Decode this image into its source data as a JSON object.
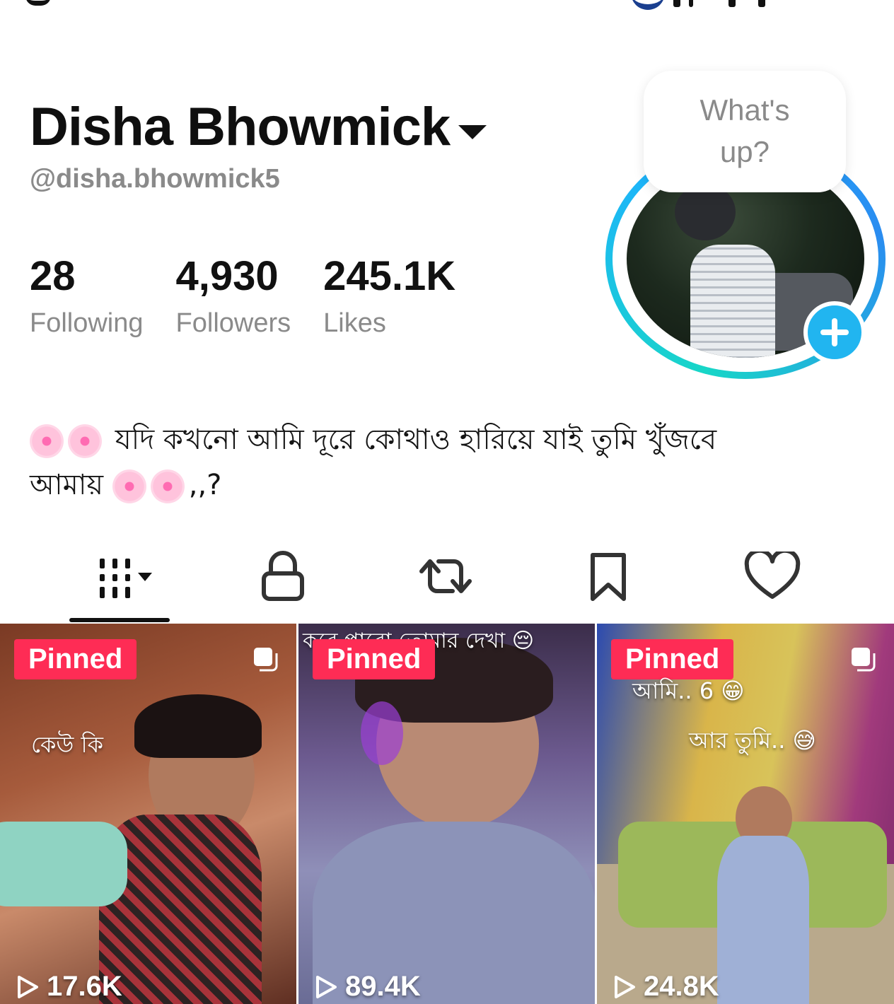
{
  "profile": {
    "display_name": "Disha Bhowmick",
    "username": "@disha.bhowmick5",
    "stats": {
      "following_value": "28",
      "following_label": "Following",
      "followers_value": "4,930",
      "followers_label": "Followers",
      "likes_value": "245.1K",
      "likes_label": "Likes"
    },
    "status_bubble": "What's up?",
    "bio_line1": "যদি কখনো আমি দূরে কোথাও হারিয়ে যাই তুমি খুঁজবে",
    "bio_line2_text": "আমায়",
    "bio_line2_suffix": ",,?"
  },
  "tabs": [
    {
      "icon": "grid-icon",
      "active": true
    },
    {
      "icon": "lock-icon",
      "active": false
    },
    {
      "icon": "repost-icon",
      "active": false
    },
    {
      "icon": "bookmark-icon",
      "active": false
    },
    {
      "icon": "heart-icon",
      "active": false
    }
  ],
  "videos": [
    {
      "pinned_label": "Pinned",
      "caption": "কেউ কি",
      "views": "17.6K"
    },
    {
      "pinned_label": "Pinned",
      "caption": "করে পাবো তোমার দেখা 😔",
      "views": "89.4K"
    },
    {
      "pinned_label": "Pinned",
      "caption": "আমি.. 6 😁",
      "caption2": "আর তুমি.. 😅",
      "views": "24.8K"
    }
  ],
  "colors": {
    "accent_pinned": "#fe2c55",
    "ring_start": "#18d6c7",
    "ring_end": "#1eb1ff",
    "add_button": "#21b5f0"
  }
}
